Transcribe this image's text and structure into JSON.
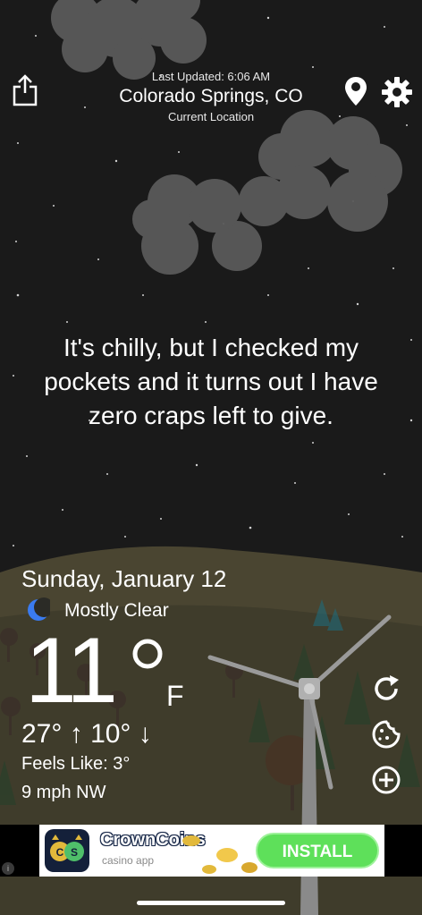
{
  "header": {
    "last_updated": "Last Updated: 6:06 AM",
    "city": "Colorado Springs, CO",
    "location_label": "Current Location"
  },
  "quip": "It's chilly, but I checked my pockets and it turns out I have zero craps left to give.",
  "weather": {
    "date": "Sunday, January 12",
    "condition": "Mostly Clear",
    "temperature": "11",
    "unit": "F",
    "high": "27°",
    "low": "10°",
    "feels_like": "Feels Like: 3°",
    "wind": "9 mph NW"
  },
  "ad": {
    "title": "CrownCoins",
    "subtitle": "casino app",
    "logo_text": "CS",
    "cta": "INSTALL",
    "info": "i"
  },
  "colors": {
    "sky": "#1a1a1a",
    "cloud": "#5a5a5a",
    "hill": "#4a4531",
    "moon": "#3a7bf0",
    "install_button": "#5ee05a"
  },
  "icons": {
    "share": "share-icon",
    "location": "location-pin-icon",
    "settings": "gear-icon",
    "condition": "crescent-moon-icon",
    "refresh": "refresh-icon",
    "cookie": "cookie-icon",
    "add": "plus-circle-icon"
  }
}
